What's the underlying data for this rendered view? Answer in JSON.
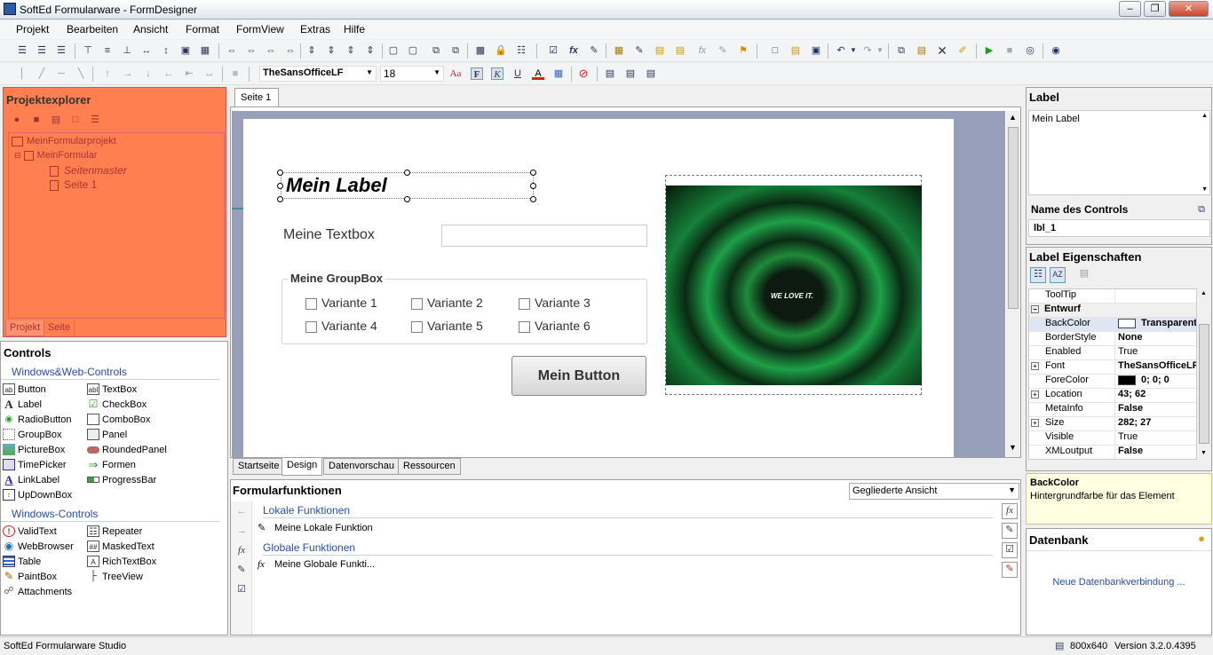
{
  "title": "SoftEd Formularware - FormDesigner",
  "menu": [
    "Projekt",
    "Bearbeiten",
    "Ansicht",
    "Format",
    "FormView",
    "Extras",
    "Hilfe"
  ],
  "font": {
    "name": "TheSansOfficeLF",
    "size": "18"
  },
  "explorer": {
    "title": "Projektexplorer",
    "project": "MeinFormularprojekt",
    "form": "MeinFormular",
    "master": "Seitenmaster",
    "page": "Seite 1",
    "tabs": [
      "Projekt",
      "Seite"
    ]
  },
  "controls": {
    "title": "Controls",
    "group1": "Windows&Web-Controls",
    "group2": "Windows-Controls",
    "col1": [
      "Button",
      "Label",
      "RadioButton",
      "GroupBox",
      "PictureBox",
      "TimePicker",
      "LinkLabel",
      "UpDownBox"
    ],
    "col2": [
      "TextBox",
      "CheckBox",
      "ComboBox",
      "Panel",
      "RoundedPanel",
      "Formen",
      "ProgressBar"
    ],
    "col3": [
      "ValidText",
      "WebBrowser",
      "Table",
      "PaintBox",
      "Attachments"
    ],
    "col4": [
      "Repeater",
      "MaskedText",
      "RichTextBox",
      "TreeView"
    ]
  },
  "designer": {
    "pagetab": "Seite 1",
    "label": "Mein Label",
    "textbox_label": "Meine Textbox",
    "groupbox": "Meine GroupBox",
    "options": [
      "Variante 1",
      "Variante 2",
      "Variante 3",
      "Variante 4",
      "Variante 5",
      "Variante 6"
    ],
    "button": "Mein Button",
    "image_text": "WE LOVE IT.",
    "bottomtabs": [
      "Startseite",
      "Design",
      "Datenvorschau",
      "Ressourcen"
    ]
  },
  "functions": {
    "title": "Formularfunktionen",
    "view": "Gegliederte Ansicht",
    "local": "Lokale Funktionen",
    "local_item": "Meine Lokale Funktion",
    "global": "Globale Funktionen",
    "global_item": "Meine Globale Funkti..."
  },
  "labelpanel": {
    "title": "Label",
    "text": "Mein Label",
    "name_title": "Name des Controls",
    "name": "lbl_1",
    "props_title": "Label Eigenschaften"
  },
  "properties": {
    "tooltip": {
      "k": "ToolTip",
      "v": ""
    },
    "section": "Entwurf",
    "rows": [
      {
        "k": "BackColor",
        "v": "Transparent",
        "bold": true,
        "swatch": "#ffffff"
      },
      {
        "k": "BorderStyle",
        "v": "None",
        "bold": true
      },
      {
        "k": "Enabled",
        "v": "True",
        "bold": false
      },
      {
        "k": "Font",
        "v": "TheSansOfficeLF",
        "bold": true,
        "expand": true
      },
      {
        "k": "ForeColor",
        "v": "0; 0; 0",
        "bold": true,
        "swatch": "#000000"
      },
      {
        "k": "Location",
        "v": "43; 62",
        "bold": true,
        "expand": true
      },
      {
        "k": "MetaInfo",
        "v": "False",
        "bold": true
      },
      {
        "k": "Size",
        "v": "282; 27",
        "bold": true,
        "expand": true
      },
      {
        "k": "Visible",
        "v": "True",
        "bold": false
      },
      {
        "k": "XMLoutput",
        "v": "False",
        "bold": true
      }
    ]
  },
  "help": {
    "title": "BackColor",
    "text": "Hintergrundfarbe für das Element"
  },
  "database": {
    "title": "Datenbank",
    "link": "Neue Datenbankverbindung ..."
  },
  "status": {
    "left": "SoftEd Formularware Studio",
    "size": "800x640",
    "version": "Version 3.2.0.4395"
  },
  "colors": {
    "explorer": "#ff7f50",
    "accent": "#2a4e9e"
  }
}
